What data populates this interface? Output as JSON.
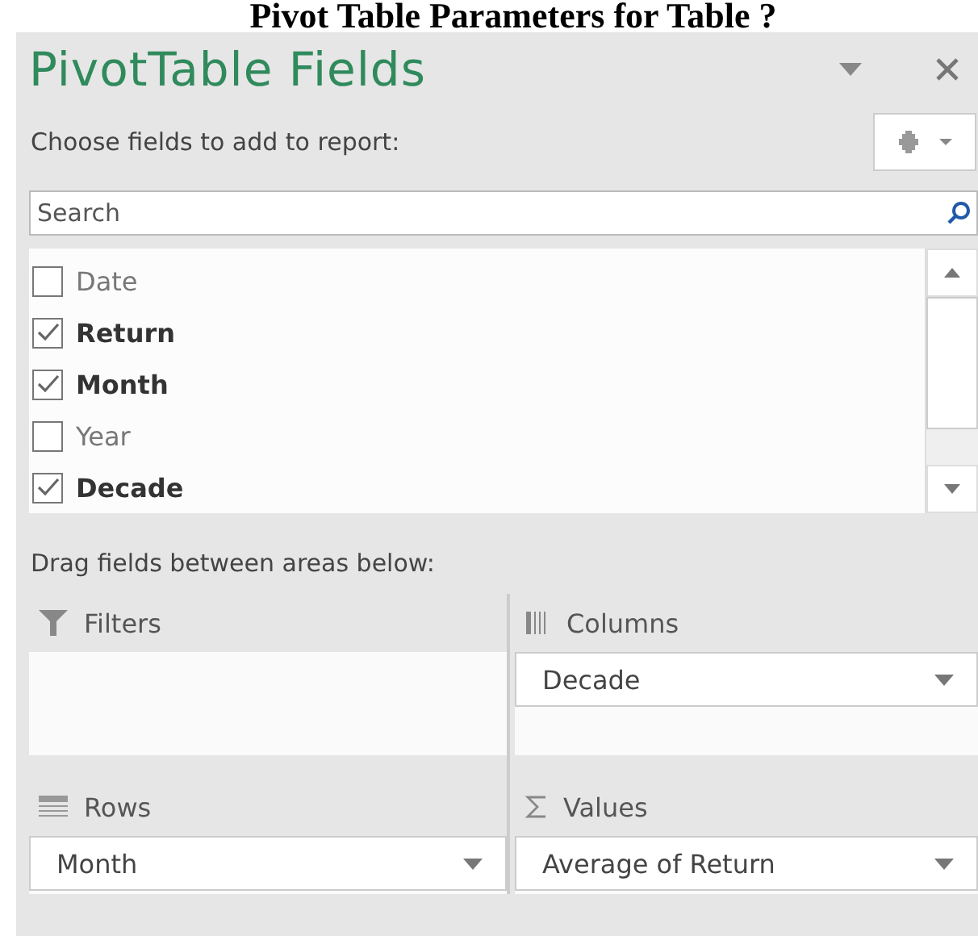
{
  "caption": "Pivot Table Parameters for Table ?",
  "panel": {
    "title": "PivotTable Fields",
    "prompt": "Choose fields to add to report:",
    "search": {
      "placeholder": "Search"
    },
    "fields": [
      {
        "label": "Date",
        "checked": false
      },
      {
        "label": "Return",
        "checked": true
      },
      {
        "label": "Month",
        "checked": true
      },
      {
        "label": "Year",
        "checked": false
      },
      {
        "label": "Decade",
        "checked": true
      }
    ],
    "areas_hint": "Drag fields between areas below:",
    "areas": [
      {
        "kind": "filters",
        "label": "Filters"
      },
      {
        "kind": "columns",
        "label": "Columns",
        "items": [
          "Decade"
        ]
      },
      {
        "kind": "rows",
        "label": "Rows",
        "items": [
          "Month"
        ]
      },
      {
        "kind": "values",
        "label": "Values",
        "items": [
          "Average of Return"
        ]
      }
    ]
  }
}
